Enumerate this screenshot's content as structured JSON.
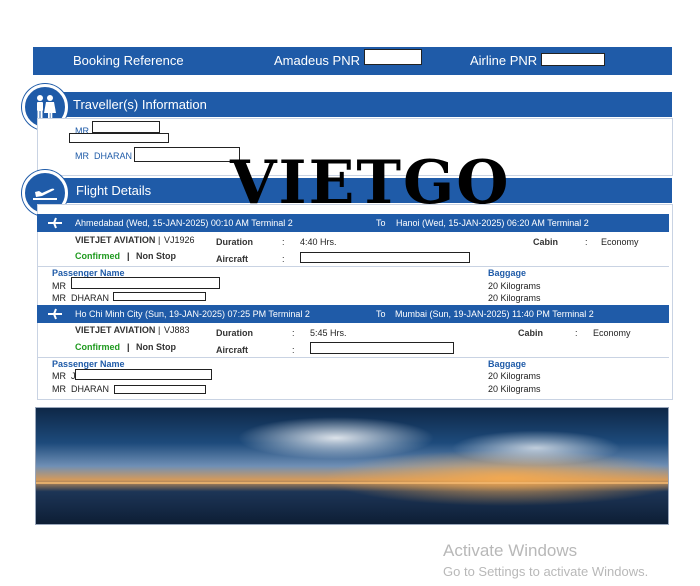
{
  "booking": {
    "title": "Booking Reference",
    "amadeus_label": "Amadeus PNR : I",
    "airline_label": "Airline PNR :"
  },
  "traveller": {
    "header": "Traveller(s) Information",
    "names": [
      "MR",
      "MR  DHARAN"
    ]
  },
  "flight_details": {
    "header": "Flight Details",
    "flights": [
      {
        "from": "Ahmedabad (Wed, 15-JAN-2025) 00:10 AM Terminal 2",
        "to_label": "To",
        "to": "Hanoi (Wed, 15-JAN-2025) 06:20 AM Terminal 2",
        "airline": "VIETJET AVIATION",
        "flight_no": "VJ1926",
        "status": "Confirmed",
        "stops": "Non Stop",
        "duration_label": "Duration",
        "duration": "4:40 Hrs.",
        "aircraft_label": "Aircraft",
        "cabin_label": "Cabin",
        "cabin": "Economy",
        "passenger_header": "Passenger Name",
        "baggage_header": "Baggage",
        "passengers": [
          "MR",
          "MR  DHARAN"
        ],
        "baggage": [
          "20 Kilograms",
          "20 Kilograms"
        ]
      },
      {
        "from": "Ho Chi Minh City (Sun, 19-JAN-2025) 07:25 PM Terminal 2",
        "to_label": "To",
        "to": "Mumbai (Sun, 19-JAN-2025) 11:40 PM Terminal 2",
        "airline": "VIETJET AVIATION",
        "flight_no": "VJ883",
        "status": "Confirmed",
        "stops": "Non Stop",
        "duration_label": "Duration",
        "duration": "5:45 Hrs.",
        "aircraft_label": "Aircraft",
        "cabin_label": "Cabin",
        "cabin": "Economy",
        "passenger_header": "Passenger Name",
        "baggage_header": "Baggage",
        "passengers": [
          "MR  J",
          "MR  DHARAN"
        ],
        "baggage": [
          "20 Kilograms",
          "20 Kilograms"
        ]
      }
    ]
  },
  "colon": ":",
  "pipe": "|",
  "watermark": "VIETGO",
  "activation": {
    "title": "Activate Windows",
    "subtitle": "Go to Settings to activate Windows."
  },
  "colors": {
    "brand_blue": "#1f5ba8",
    "confirmed_green": "#1f9a1f"
  },
  "icons": [
    "travellers-icon",
    "airplane-icon"
  ]
}
